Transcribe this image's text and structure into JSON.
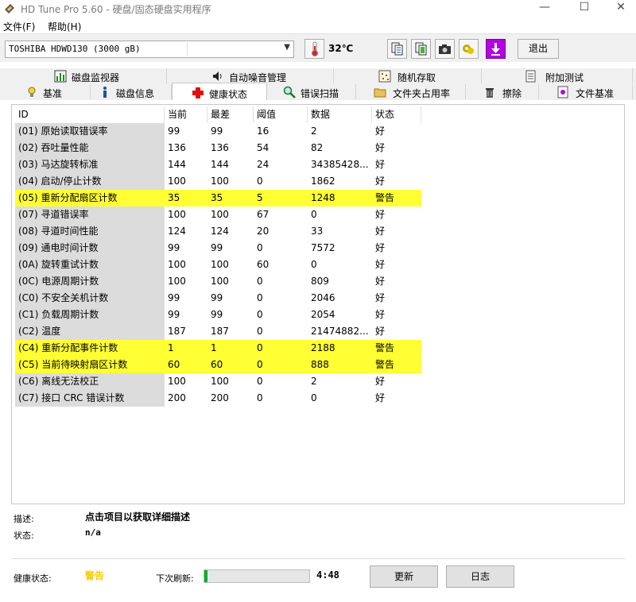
{
  "window": {
    "title": "HD Tune Pro 5.60 - 硬盘/固态硬盘实用程序",
    "minimize": "—",
    "maximize": "☐",
    "close": "✕"
  },
  "menu": {
    "file": "文件(F)",
    "help": "帮助(H)"
  },
  "toolbar": {
    "drive": "TOSHIBA HDWD130 (3000 gB)",
    "temperature": "32℃",
    "exit_label": "退出",
    "icons": [
      "thermometer-icon",
      "copy-text-icon",
      "copy-all-icon",
      "screenshot-icon",
      "options-icon",
      "save-icon"
    ]
  },
  "tabs_top": [
    {
      "label": "磁盘监视器",
      "icon": "disk-monitor-icon"
    },
    {
      "label": "自动噪音管理",
      "icon": "speaker-icon"
    },
    {
      "label": "随机存取",
      "icon": "random-access-icon"
    },
    {
      "label": "附加测试",
      "icon": "extra-tests-icon"
    }
  ],
  "tabs_bottom": [
    {
      "label": "基准",
      "icon": "benchmark-icon"
    },
    {
      "label": "磁盘信息",
      "icon": "info-icon"
    },
    {
      "label": "健康状态",
      "icon": "health-cross-icon"
    },
    {
      "label": "错误扫描",
      "icon": "magnifier-icon"
    },
    {
      "label": "文件夹占用率",
      "icon": "folder-icon"
    },
    {
      "label": "擦除",
      "icon": "trash-icon"
    },
    {
      "label": "文件基准",
      "icon": "file-benchmark-icon"
    }
  ],
  "table": {
    "headers": [
      "ID",
      "当前",
      "最差",
      "阈值",
      "数据",
      "状态"
    ],
    "rows": [
      [
        "(01) 原始读取错误率",
        "99",
        "99",
        "16",
        "2",
        "好"
      ],
      [
        "(02) 吞吐量性能",
        "136",
        "136",
        "54",
        "82",
        "好"
      ],
      [
        "(03) 马达旋转标准",
        "144",
        "144",
        "24",
        "34385428...",
        "好"
      ],
      [
        "(04) 启动/停止计数",
        "100",
        "100",
        "0",
        "1862",
        "好"
      ],
      [
        "(05) 重新分配扇区计数",
        "35",
        "35",
        "5",
        "1248",
        "警告"
      ],
      [
        "(07) 寻道错误率",
        "100",
        "100",
        "67",
        "0",
        "好"
      ],
      [
        "(08) 寻道时间性能",
        "124",
        "124",
        "20",
        "33",
        "好"
      ],
      [
        "(09) 通电时间计数",
        "99",
        "99",
        "0",
        "7572",
        "好"
      ],
      [
        "(0A) 旋转重试计数",
        "100",
        "100",
        "60",
        "0",
        "好"
      ],
      [
        "(0C) 电源周期计数",
        "100",
        "100",
        "0",
        "809",
        "好"
      ],
      [
        "(C0) 不安全关机计数",
        "99",
        "99",
        "0",
        "2046",
        "好"
      ],
      [
        "(C1) 负载周期计数",
        "99",
        "99",
        "0",
        "2054",
        "好"
      ],
      [
        "(C2) 温度",
        "187",
        "187",
        "0",
        "21474882...",
        "好"
      ],
      [
        "(C4) 重新分配事件计数",
        "1",
        "1",
        "0",
        "2188",
        "警告"
      ],
      [
        "(C5) 当前待映射扇区计数",
        "60",
        "60",
        "0",
        "888",
        "警告"
      ],
      [
        "(C6) 离线无法校正",
        "100",
        "100",
        "0",
        "2",
        "好"
      ],
      [
        "(C7) 接口 CRC 错误计数",
        "200",
        "200",
        "0",
        "0",
        "好"
      ]
    ],
    "warning_rows": [
      4,
      13,
      14
    ],
    "warning_color": "#ffff33"
  },
  "details": {
    "description_label": "描述:",
    "description_value": "点击项目以获取详细描述",
    "status_label": "状态:",
    "status_value": "n/a"
  },
  "footer": {
    "health_label": "健康状态:",
    "health_value": "警告",
    "next_refresh_label": "下次刷新:",
    "refresh_progress": 0.03,
    "countdown": "4:48",
    "refresh_button": "更新",
    "log_button": "日志"
  }
}
